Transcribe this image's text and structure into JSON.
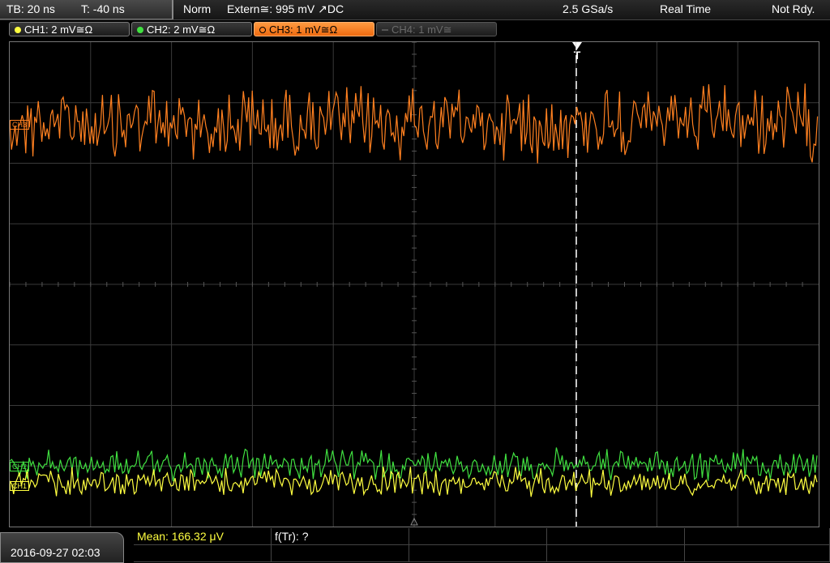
{
  "status_bar": {
    "timebase": "TB: 20 ns",
    "trigger_offset": "T: -40 ns",
    "trigger_mode": "Norm",
    "trigger_source": "Extern≅: 995 mV ↗DC",
    "sample_rate": "2.5 GSa/s",
    "acq_mode": "Real Time",
    "acq_status": "Not Rdy."
  },
  "channels": [
    {
      "label": "CH1: 2 mV≅Ω",
      "color": "#ffff40",
      "state": "on"
    },
    {
      "label": "CH2: 2 mV≅Ω",
      "color": "#40e040",
      "state": "on"
    },
    {
      "label": "CH3: 1 mV≅Ω",
      "color": "#ff8020",
      "state": "active"
    },
    {
      "label": "CH4: 1 mV≅",
      "color": "#606060",
      "state": "off"
    }
  ],
  "trigger_marker": "T",
  "level_labels": {
    "ch3": "CH3",
    "ch2": "CH2",
    "ch1": "CH1"
  },
  "measurements": {
    "mean": "Mean: 166.32 μV",
    "freq": "f(Tr): ?"
  },
  "datetime": "2016-09-27 02:03",
  "colors": {
    "ch1": "#ffff40",
    "ch2": "#40e040",
    "ch3": "#ff8020",
    "grid": "#3a3a3a"
  }
}
